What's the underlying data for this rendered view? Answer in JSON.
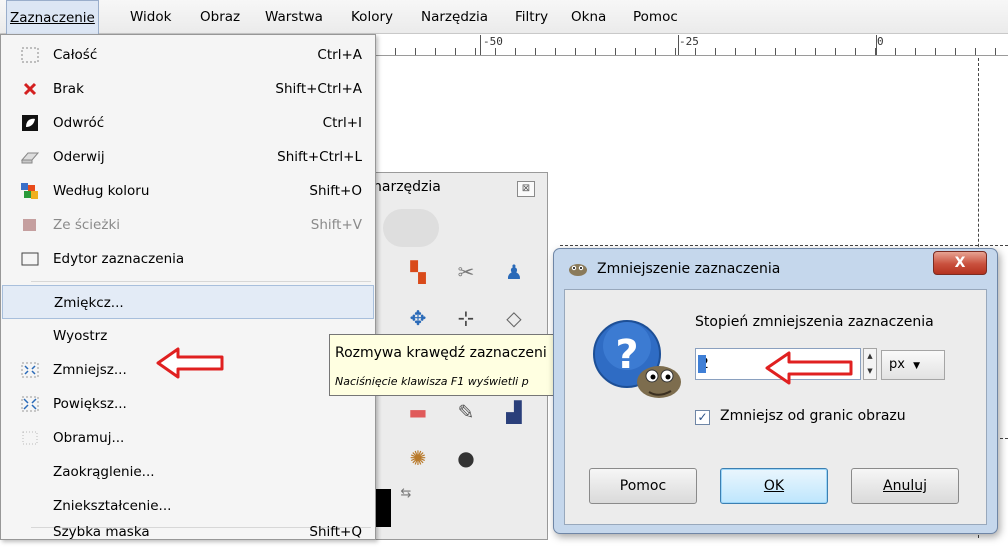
{
  "menubar": {
    "items": [
      {
        "label": "Zaznaczenie",
        "active": true
      },
      {
        "label": "Widok"
      },
      {
        "label": "Obraz"
      },
      {
        "label": "Warstwa"
      },
      {
        "label": "Kolory"
      },
      {
        "label": "Narzędzia"
      },
      {
        "label": "Filtry"
      },
      {
        "label": "Okna"
      },
      {
        "label": "Pomoc"
      }
    ]
  },
  "ruler": {
    "labels": [
      "-50",
      "-25",
      "0"
    ]
  },
  "dropdown": {
    "items": [
      {
        "label": "Całość",
        "shortcut": "Ctrl+A",
        "icon": "select-all-icon"
      },
      {
        "label": "Brak",
        "shortcut": "Shift+Ctrl+A",
        "icon": "select-none-icon"
      },
      {
        "label": "Odwróć",
        "shortcut": "Ctrl+I",
        "icon": "invert-selection-icon"
      },
      {
        "label": "Oderwij",
        "shortcut": "Shift+Ctrl+L",
        "icon": "float-selection-icon"
      },
      {
        "label": "Według koloru",
        "shortcut": "Shift+O",
        "icon": "select-by-color-icon"
      },
      {
        "label": "Ze ścieżki",
        "shortcut": "Shift+V",
        "icon": "from-path-icon",
        "disabled": true
      },
      {
        "label": "Edytor zaznaczenia",
        "shortcut": "",
        "icon": "selection-editor-icon"
      },
      {
        "label": "Zmiękcz...",
        "shortcut": "",
        "icon": "",
        "hover": true
      },
      {
        "label": "Wyostrz",
        "shortcut": "",
        "icon": ""
      },
      {
        "label": "Zmniejsz...",
        "shortcut": "",
        "icon": "shrink-selection-icon"
      },
      {
        "label": "Powiększ...",
        "shortcut": "",
        "icon": "grow-selection-icon"
      },
      {
        "label": "Obramuj...",
        "shortcut": "",
        "icon": "border-selection-icon"
      },
      {
        "label": "Zaokrąglenie...",
        "shortcut": "",
        "icon": ""
      },
      {
        "label": "Zniekształcenie...",
        "shortcut": "",
        "icon": ""
      },
      {
        "label": "Szybka maska",
        "shortcut": "Shift+Q",
        "icon": ""
      }
    ]
  },
  "toolbox": {
    "title": "narzędzia",
    "close_label": "⊠"
  },
  "tooltip": {
    "main": "Rozmywa krawędź zaznaczeni",
    "hint": "Naciśnięcie klawisza F1 wyświetli p"
  },
  "dialog": {
    "title": "Zmniejszenie zaznaczenia",
    "close_label": "X",
    "prompt": "Stopień zmniejszenia zaznaczenia",
    "value": "2",
    "unit": "px",
    "checkbox_label": "Zmniejsz od granic obrazu",
    "checkbox_checked": true,
    "buttons": {
      "help": "Pomoc",
      "ok": "OK",
      "cancel": "Anuluj"
    }
  },
  "colors": {
    "menu_hover": "#e3ebf6",
    "dialog_frame": "#c5d7ec",
    "annotation_red": "#e02020"
  }
}
